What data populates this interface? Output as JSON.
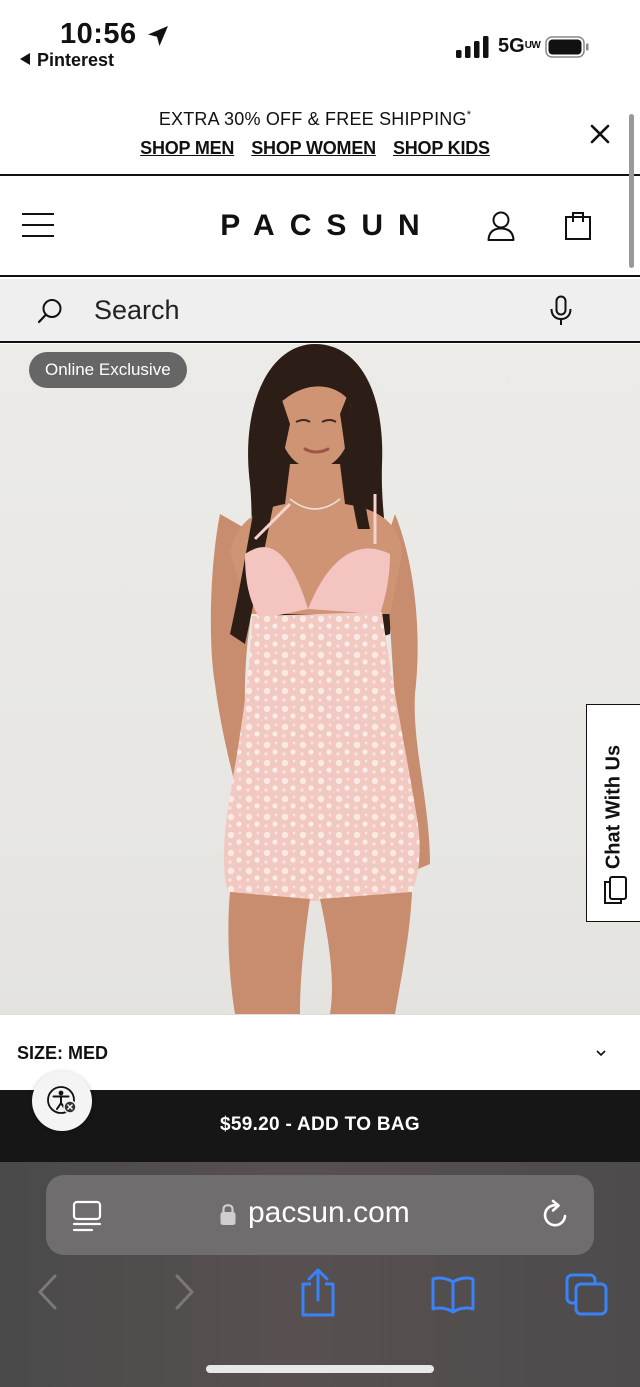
{
  "status_bar": {
    "time": "10:56",
    "back_app": "Pinterest",
    "network": "5G",
    "network_suffix": "UW"
  },
  "promo": {
    "text": "EXTRA 30% OFF & FREE SHIPPING",
    "mark": "*",
    "links": [
      "SHOP MEN",
      "SHOP WOMEN",
      "SHOP KIDS"
    ]
  },
  "header": {
    "logo": "PACSUN"
  },
  "search": {
    "placeholder": "Search"
  },
  "product": {
    "badge": "Online Exclusive",
    "chat_label": "Chat With Us"
  },
  "size": {
    "label": "SIZE:",
    "value": "MED"
  },
  "add_to_bag": {
    "label": "$59.20 - ADD TO BAG"
  },
  "browser": {
    "url": "pacsun.com"
  },
  "colors": {
    "accent_blue": "#3a82f7",
    "dark_bar": "#161616",
    "badge_gray": "#666666",
    "dress_pink": "#f2c6c0"
  }
}
